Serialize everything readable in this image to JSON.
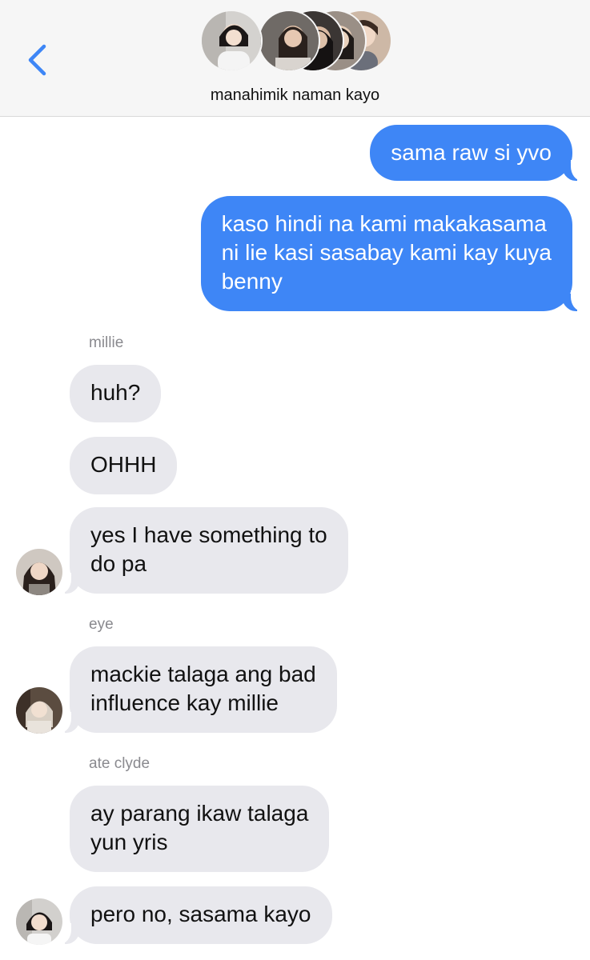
{
  "header": {
    "group_name": "manahimik naman kayo",
    "back_icon": "chevron-left-icon",
    "accent": "#3e86f6"
  },
  "colors": {
    "sent_bubble": "#3e86f6",
    "received_bubble": "#e8e8ed",
    "sender_name": "#8a8a8f"
  },
  "messages": {
    "m1": "sama raw si yvo",
    "m2_l1": "kaso hindi na kami makakasama",
    "m2_l2": "ni lie kasi sasabay kami kay kuya",
    "m2_l3": "benny",
    "sender_millie": "millie",
    "m3": "huh?",
    "m4": "OHHH",
    "m5_l1": "yes I have something to",
    "m5_l2": "do pa",
    "sender_eye": "eye",
    "m6_l1": "mackie talaga ang bad",
    "m6_l2": "influence kay millie",
    "sender_clyde": "ate clyde",
    "m7_l1": "ay parang ikaw talaga",
    "m7_l2": "yun yris",
    "m8": "pero no, sasama kayo"
  }
}
